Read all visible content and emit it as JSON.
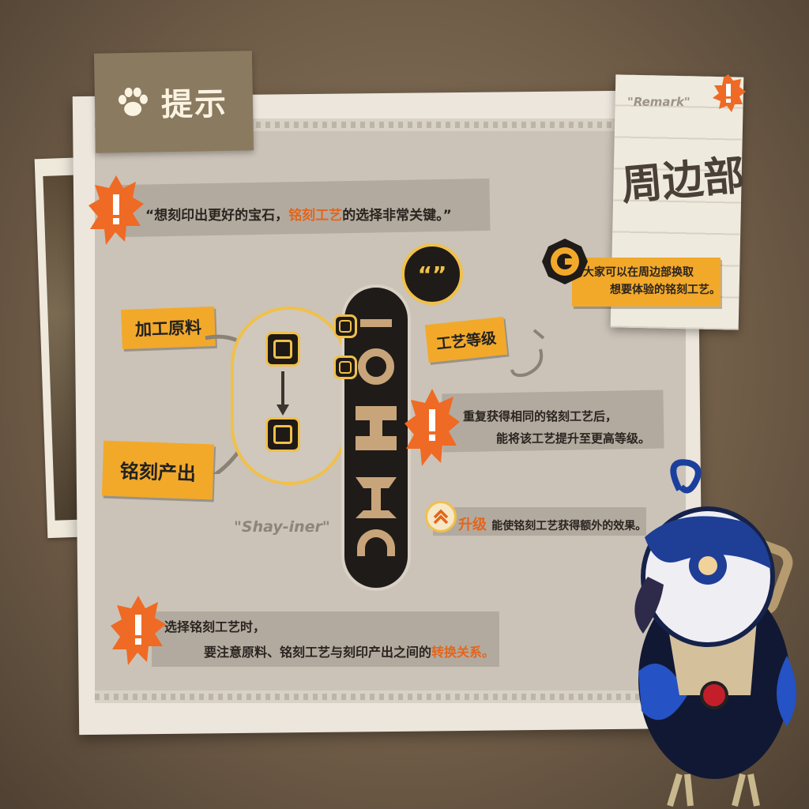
{
  "title": "提示",
  "remark": {
    "label": "\"Remark\"",
    "title": "周边部",
    "note_line1": "大家可以在周边部换取",
    "note_line2": "想要体验的铭刻工艺。"
  },
  "tip_top": {
    "prefix": "“想刻印出更好的宝石，",
    "highlight": "铭刻工艺",
    "suffix": "的选择非常关键。”"
  },
  "labels": {
    "material": "加工原料",
    "output": "铭刻产出",
    "craft_level": "工艺等级",
    "shay": "\"Shay-iner\"",
    "bubble": "“”"
  },
  "level_tip": {
    "line1": "重复获得相同的铭刻工艺后，",
    "line2": "能将该工艺提升至更高等级。"
  },
  "upgrade_tip": {
    "highlight": "升级",
    "text": "能使铭刻工艺获得额外的效果。"
  },
  "tip_bottom": {
    "line1": "选择铭刻工艺时，",
    "line2_prefix": "要注意原料、铭刻工艺与刻印产出之间的",
    "line2_highlight": "转换关系。"
  },
  "icons": [
    "paw-icon",
    "exclamation-icon",
    "gear-coin-icon",
    "upgrade-chevron-icon",
    "speech-bubble-icon",
    "mascot-bird"
  ],
  "colors": {
    "accent": "#f2a92a",
    "highlight": "#e2661c",
    "burst": "#ef6a24",
    "dark": "#1f1b18"
  }
}
